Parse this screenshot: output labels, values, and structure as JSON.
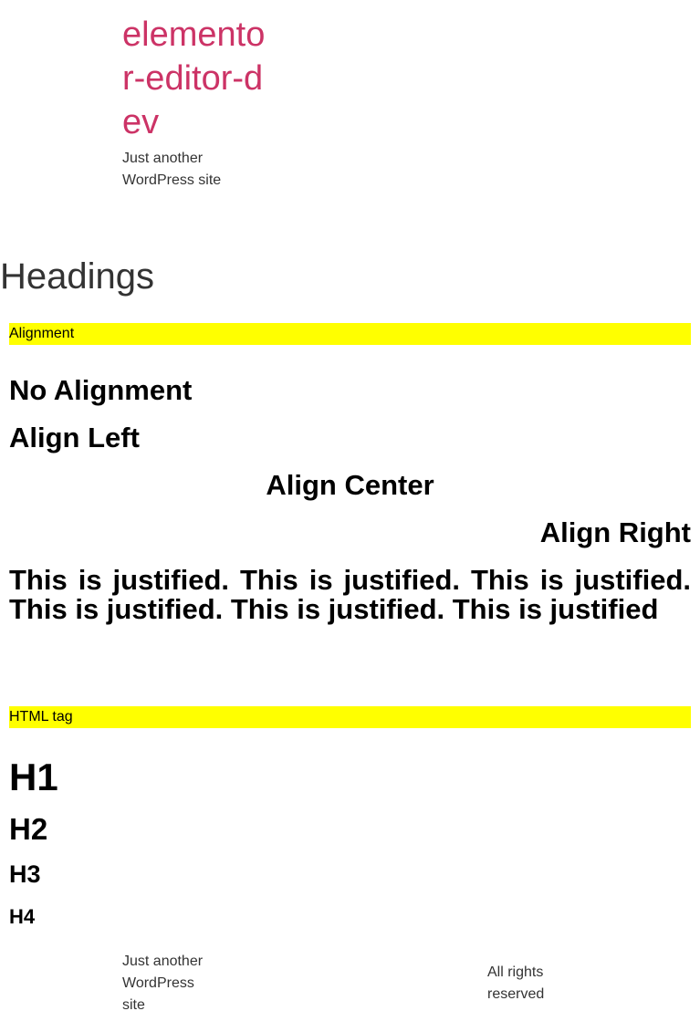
{
  "site": {
    "title": "elementor-editor-dev",
    "tagline": "Just another WordPress site",
    "title_color": "#cc3366"
  },
  "page": {
    "heading": "Headings"
  },
  "sections": {
    "alignment": {
      "label": "Alignment",
      "bar_color": "#ffff00",
      "headings": {
        "no_alignment": "No Alignment",
        "align_left": "Align Left",
        "align_center": "Align Center",
        "align_right": "Align Right",
        "justified": "This is justified. This is justified. This is justified. This is justified. This is justified. This is justified"
      }
    },
    "html_tag": {
      "label": "HTML tag",
      "bar_color": "#ffff00",
      "headings": {
        "h1": "H1",
        "h2": "H2",
        "h3": "H3",
        "h4": "H4"
      }
    }
  },
  "footer": {
    "tagline": "Just another WordPress site",
    "rights": "All rights reserved"
  }
}
